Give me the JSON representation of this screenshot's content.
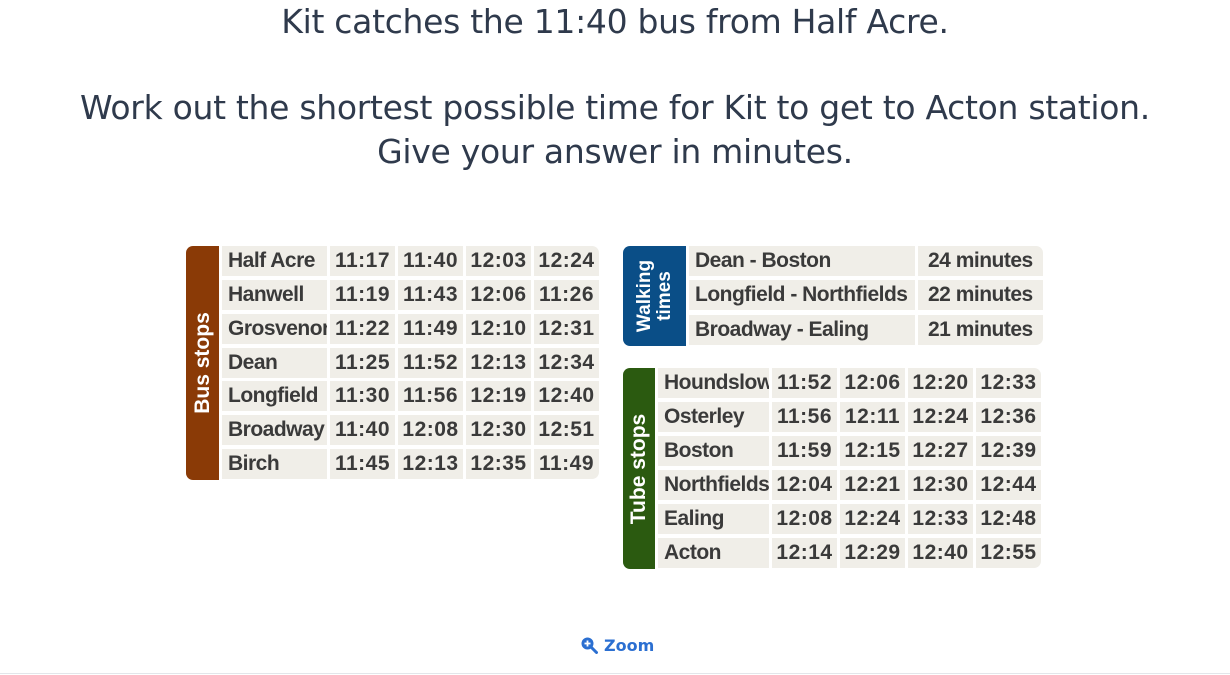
{
  "question": {
    "line1": "Kit catches the 11:40 bus from Half Acre.",
    "line2": "Work out the shortest possible time for Kit to get to Acton station.",
    "line3": "Give your answer in minutes."
  },
  "bus": {
    "label": "Bus stops",
    "color": "#8a3a06",
    "rows": [
      {
        "stop": "Half Acre",
        "times": [
          "11:17",
          "11:40",
          "12:03",
          "12:24"
        ]
      },
      {
        "stop": "Hanwell",
        "times": [
          "11:19",
          "11:43",
          "12:06",
          "11:26"
        ]
      },
      {
        "stop": "Grosvenor",
        "times": [
          "11:22",
          "11:49",
          "12:10",
          "12:31"
        ]
      },
      {
        "stop": "Dean",
        "times": [
          "11:25",
          "11:52",
          "12:13",
          "12:34"
        ]
      },
      {
        "stop": "Longfield",
        "times": [
          "11:30",
          "11:56",
          "12:19",
          "12:40"
        ]
      },
      {
        "stop": "Broadway",
        "times": [
          "11:40",
          "12:08",
          "12:30",
          "12:51"
        ]
      },
      {
        "stop": "Birch",
        "times": [
          "11:45",
          "12:13",
          "12:35",
          "11:49"
        ]
      }
    ]
  },
  "walking": {
    "label_line1": "Walking",
    "label_line2": "times",
    "color": "#0a4e87",
    "rows": [
      {
        "route": "Dean - Boston",
        "time": "24 minutes"
      },
      {
        "route": "Longfield - Northfields",
        "time": "22 minutes"
      },
      {
        "route": "Broadway - Ealing",
        "time": "21 minutes"
      }
    ]
  },
  "tube": {
    "label": "Tube stops",
    "color": "#2b5a10",
    "rows": [
      {
        "stop": "Houndslow",
        "times": [
          "11:52",
          "12:06",
          "12:20",
          "12:33"
        ]
      },
      {
        "stop": "Osterley",
        "times": [
          "11:56",
          "12:11",
          "12:24",
          "12:36"
        ]
      },
      {
        "stop": "Boston",
        "times": [
          "11:59",
          "12:15",
          "12:27",
          "12:39"
        ]
      },
      {
        "stop": "Northfields",
        "times": [
          "12:04",
          "12:21",
          "12:30",
          "12:44"
        ]
      },
      {
        "stop": "Ealing",
        "times": [
          "12:08",
          "12:24",
          "12:33",
          "12:48"
        ]
      },
      {
        "stop": "Acton",
        "times": [
          "12:14",
          "12:29",
          "12:40",
          "12:55"
        ]
      }
    ]
  },
  "zoom": {
    "label": "Zoom",
    "icon": "zoom-in-icon",
    "color": "#2b6fd1"
  }
}
